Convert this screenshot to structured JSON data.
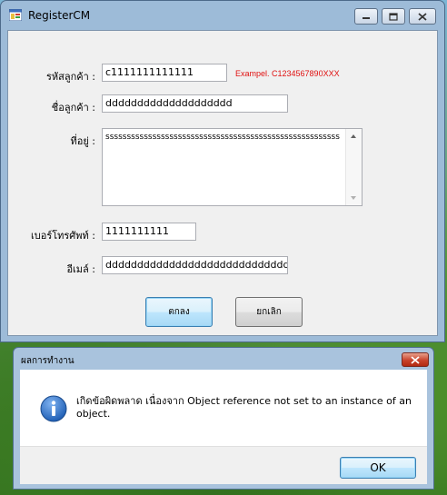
{
  "window": {
    "title": "RegisterCM",
    "icons": {
      "app": "app-form-icon",
      "minimize": "minimize-icon",
      "maximize": "maximize-icon",
      "close": "close-icon"
    }
  },
  "form": {
    "customer_id": {
      "label": "รหัสลูกค้า :",
      "value": "c1111111111111",
      "hint": "Exampel. C1234567890XXX"
    },
    "customer_name": {
      "label": "ชื่อลูกค้า :",
      "value": "dddddddddddddddddddd"
    },
    "address": {
      "label": "ที่อยู่ :",
      "value": "sssssssssssssssssssssssssssssssssssssssssssssssssssssss"
    },
    "phone": {
      "label": "เบอร์โทรศัพท์ :",
      "value": "1111111111"
    },
    "email": {
      "label": "อีเมล์ :",
      "value": "dddddddddddddddddddddddddddddddd"
    },
    "ok_label": "ตกลง",
    "cancel_label": "ยกเลิก"
  },
  "dialog": {
    "title": "ผลการทำงาน",
    "message": "เกิดข้อผิดพลาด เนื่องจาก Object reference not set to an instance of an object.",
    "ok_label": "OK",
    "icon": "information-icon"
  },
  "colors": {
    "hint": "#e01010",
    "info_icon": "#1f5fb5"
  }
}
